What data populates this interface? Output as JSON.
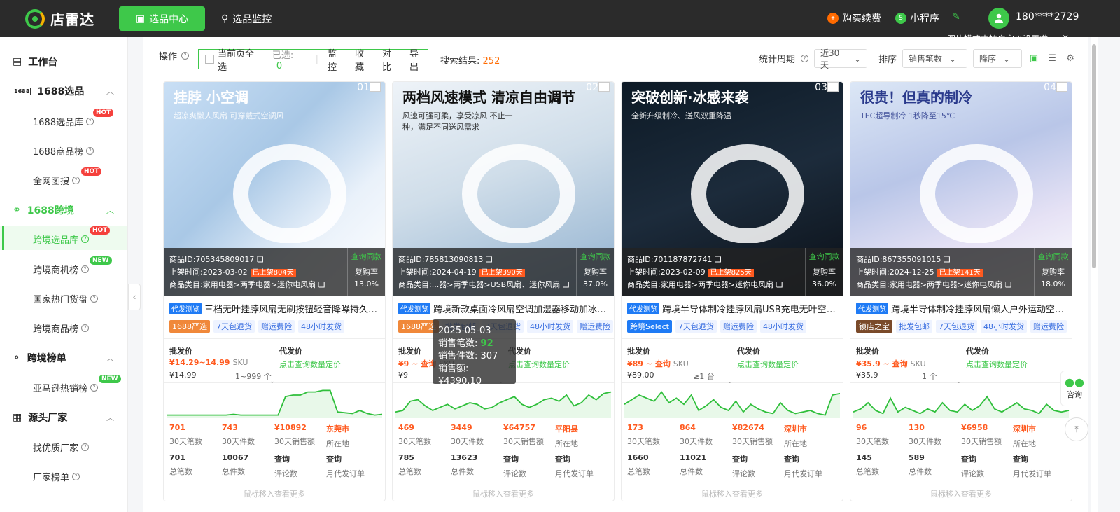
{
  "header": {
    "brand": "店雷达",
    "nav_active": "选品中心",
    "nav_monitor": "选品监控",
    "buy": "购买续费",
    "mini": "小程序",
    "user": "180****2729",
    "tip": "图片模式支持自定义设置啦"
  },
  "sidebar": {
    "workbench": "工作台",
    "g1": "1688选品",
    "g1_items": [
      "1688选品库",
      "1688商品榜",
      "全网图搜"
    ],
    "g2": "1688跨境",
    "g2_items": [
      "跨境选品库",
      "跨境商机榜",
      "国家热门货盘",
      "跨境商品榜"
    ],
    "g3": "跨境榜单",
    "g3_items": [
      "亚马逊热销榜"
    ],
    "g4": "源头厂家",
    "g4_items": [
      "找优质厂家",
      "厂家榜单"
    ],
    "hot": "HOT",
    "new": "NEW"
  },
  "toolbar": {
    "op": "操作",
    "select_all": "当前页全选",
    "selected": "已选:",
    "selected_count": "0",
    "monitor": "监控",
    "fav": "收藏",
    "compare": "对比",
    "export": "导出",
    "result_label": "搜索结果:",
    "result_count": "252",
    "period": "统计周期",
    "period_val": "近30天",
    "sort": "排序",
    "sort_field": "销售笔数",
    "sort_dir": "降序"
  },
  "labels": {
    "id": "商品ID:",
    "listed": "上架时间:",
    "cat": "商品类目:",
    "query_same": "查询同款",
    "repurchase": "复购率",
    "wholesale": "批发价",
    "dropship": "代发价",
    "dropship_tip": "点击查询数量定价",
    "k30cnt": "30天笔数",
    "k30pcs": "30天件数",
    "k30amt": "30天销售额",
    "kloc": "所在地",
    "ktotal": "总笔数",
    "kpcs": "总件数",
    "kreview": "评论数",
    "kmonthly": "月代发订单",
    "query": "查询",
    "foot": "鼠标移入查看更多",
    "consult": "咨询"
  },
  "cards": [
    {
      "no": "01",
      "id": "705345809017",
      "date": "2023-03-02",
      "days": "已上架804天",
      "cat": "家用电器>两季电器>迷你电风扇",
      "rate": "13.0%",
      "badge": "代发测览",
      "title": "三档无叶挂脖风扇无刷按钮轻音降噪持久续航",
      "tags": [
        "1688严选",
        "7天包退货",
        "赠运费险",
        "48小时发货"
      ],
      "price": "¥14.29~14.99",
      "unit": "SKU",
      "base": "¥14.99",
      "moq": "1~999 个",
      "s30": "701",
      "p30": "743",
      "a30": "¥10892",
      "loc": "东莞市",
      "tot": "701",
      "pcs": "10067",
      "rev": "查询",
      "mon": "查询",
      "img": "挂脖 小空调",
      "img2": "超凉爽懒人风扇 可穿戴式空调风",
      "series": [
        4,
        4,
        4,
        4,
        4,
        4,
        4,
        4,
        4,
        5,
        4,
        4,
        4,
        4,
        4,
        4,
        28,
        30,
        30,
        34,
        34,
        36,
        36,
        8,
        7,
        6,
        10,
        6,
        4,
        5
      ]
    },
    {
      "no": "02",
      "id": "785813090813",
      "date": "2024-04-19",
      "days": "已上架390天",
      "cat": "...器>两季电器>USB风扇、迷你风扇",
      "rate": "37.0%",
      "badge": "代发测览",
      "title": "跨境新款桌面冷风扇空调加湿器移动加冰冷风机",
      "tags": [
        "1688严选",
        "批发包邮",
        "7天包退货",
        "48小时发货",
        "赠运费险"
      ],
      "price": "¥9 ~ 查询",
      "unit": "SKU",
      "base": "¥9",
      "moq": "",
      "s30": "469",
      "p30": "3449",
      "a30": "¥64757",
      "loc": "平阳县",
      "tot": "785",
      "pcs": "13623",
      "rev": "查询",
      "mon": "查询",
      "img": "两档风速模式 清凉自由调节",
      "img2": "风速可强可柔，享受凉风 不止一种，满足不同送风需求",
      "series": [
        8,
        10,
        22,
        24,
        16,
        10,
        14,
        18,
        12,
        16,
        20,
        18,
        12,
        14,
        20,
        24,
        28,
        18,
        14,
        18,
        24,
        26,
        22,
        30,
        16,
        20,
        30,
        24,
        32,
        34
      ]
    },
    {
      "no": "03",
      "id": "701187872741",
      "date": "2023-02-09",
      "days": "已上架825天",
      "cat": "家用电器>两季电器>迷你电风扇",
      "rate": "36.0%",
      "badge": "代发测览",
      "title": "跨境半导体制冷挂脖风扇USB充电无叶空调风扇",
      "tags": [
        "跨境Select",
        "7天包退货",
        "赠运费险",
        "48小时发货"
      ],
      "price": "¥89 ~ 查询",
      "unit": "SKU",
      "base": "¥89.00",
      "moq": "≥1 台",
      "s30": "173",
      "p30": "864",
      "a30": "¥82674",
      "loc": "深圳市",
      "tot": "1660",
      "pcs": "11021",
      "rev": "查询",
      "mon": "查询",
      "img": "突破创新·冰感来袭",
      "img2": "全新升级制冷、送风双重降温",
      "series": [
        18,
        24,
        30,
        26,
        22,
        34,
        20,
        26,
        18,
        30,
        10,
        16,
        24,
        14,
        10,
        22,
        8,
        18,
        12,
        8,
        6,
        20,
        10,
        6,
        8,
        10,
        6,
        4,
        30,
        32
      ]
    },
    {
      "no": "04",
      "id": "867355091015",
      "date": "2024-12-25",
      "days": "已上架141天",
      "cat": "家用电器>两季电器>迷你电风扇",
      "rate": "18.0%",
      "badge": "代发测览",
      "title": "跨境半导体制冷挂脖风扇懒人户外运动空调风扇",
      "tags": [
        "镇店之宝",
        "批发包邮",
        "7天包退货",
        "48小时发货",
        "赠运费险"
      ],
      "price": "¥35.9 ~ 查询",
      "unit": "SKU",
      "base": "¥35.9",
      "moq": "1 个",
      "s30": "96",
      "p30": "130",
      "a30": "¥6958",
      "loc": "深圳市",
      "tot": "145",
      "pcs": "589",
      "rev": "查询",
      "mon": "查询",
      "img": "很贵！但真的制冷",
      "img2": "TEC超导制冷 1秒降至15℃",
      "series": [
        8,
        12,
        20,
        10,
        6,
        26,
        8,
        14,
        10,
        6,
        12,
        8,
        20,
        10,
        8,
        18,
        10,
        16,
        28,
        12,
        8,
        14,
        20,
        12,
        10,
        6,
        18,
        10,
        8,
        10
      ]
    }
  ],
  "hover": {
    "date": "2025-05-03",
    "l1": "销售笔数:",
    "v1": "92",
    "l2": "销售件数:",
    "v2": "307",
    "l3": "销售额:",
    "v3": "¥4390.10"
  }
}
